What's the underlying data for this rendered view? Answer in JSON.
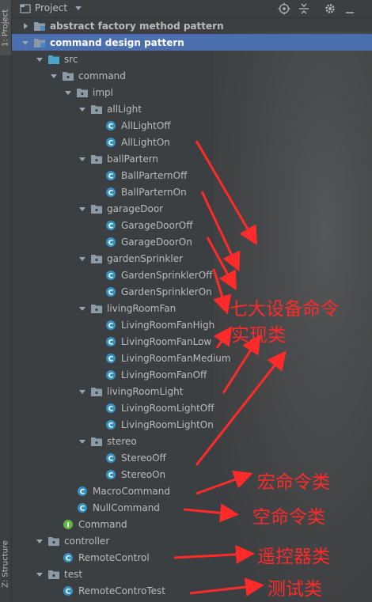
{
  "toolwindow": {
    "title": "Project",
    "left_tabs": {
      "project": "1: Project",
      "structure": "Z: Structure"
    }
  },
  "tree": [
    {
      "label": "abstract factory method pattern",
      "type": "module",
      "arrow": "right",
      "bold": true
    },
    {
      "label": "command design pattern",
      "type": "module",
      "arrow": "down",
      "bold": true,
      "selected": true
    },
    {
      "label": "src",
      "type": "src-folder",
      "arrow": "down"
    },
    {
      "label": "command",
      "type": "package",
      "arrow": "down"
    },
    {
      "label": "impl",
      "type": "package",
      "arrow": "down"
    },
    {
      "label": "allLight",
      "type": "package",
      "arrow": "down"
    },
    {
      "label": "AllLightOff",
      "type": "class"
    },
    {
      "label": "AllLightOn",
      "type": "class"
    },
    {
      "label": "ballPartern",
      "type": "package",
      "arrow": "down"
    },
    {
      "label": "BallParternOff",
      "type": "class"
    },
    {
      "label": "BallParternOn",
      "type": "class"
    },
    {
      "label": "garageDoor",
      "type": "package",
      "arrow": "down"
    },
    {
      "label": "GarageDoorOff",
      "type": "class"
    },
    {
      "label": "GarageDoorOn",
      "type": "class"
    },
    {
      "label": "gardenSprinkler",
      "type": "package",
      "arrow": "down"
    },
    {
      "label": "GardenSprinklerOff",
      "type": "class"
    },
    {
      "label": "GardenSprinklerOn",
      "type": "class"
    },
    {
      "label": "livingRoomFan",
      "type": "package",
      "arrow": "down"
    },
    {
      "label": "LivingRoomFanHigh",
      "type": "class"
    },
    {
      "label": "LivingRoomFanLow",
      "type": "class"
    },
    {
      "label": "LivingRoomFanMedium",
      "type": "class"
    },
    {
      "label": "LivingRoomFanOff",
      "type": "class"
    },
    {
      "label": "livingRoomLight",
      "type": "package",
      "arrow": "down"
    },
    {
      "label": "LivingRoomLightOff",
      "type": "class"
    },
    {
      "label": "LivingRoomLightOn",
      "type": "class"
    },
    {
      "label": "stereo",
      "type": "package",
      "arrow": "down"
    },
    {
      "label": "StereoOff",
      "type": "class"
    },
    {
      "label": "StereoOn",
      "type": "class"
    },
    {
      "label": "MacroCommand",
      "type": "class"
    },
    {
      "label": "NullCommand",
      "type": "class"
    },
    {
      "label": "Command",
      "type": "interface"
    },
    {
      "label": "controller",
      "type": "package",
      "arrow": "down"
    },
    {
      "label": "RemoteControl",
      "type": "class"
    },
    {
      "label": "test",
      "type": "package",
      "arrow": "down"
    },
    {
      "label": "RemoteControTest",
      "type": "class"
    }
  ],
  "annotations": {
    "impl_line1": "七大设备命令",
    "impl_line2": "实现类",
    "macro": "宏命令类",
    "null": "空命令类",
    "remote": "遥控器类",
    "test": "测试类"
  },
  "colors": {
    "annotation": "#ff2a2a",
    "selection": "#4b6eaf",
    "class_icon": "#3592c4",
    "interface_icon": "#62b543"
  }
}
